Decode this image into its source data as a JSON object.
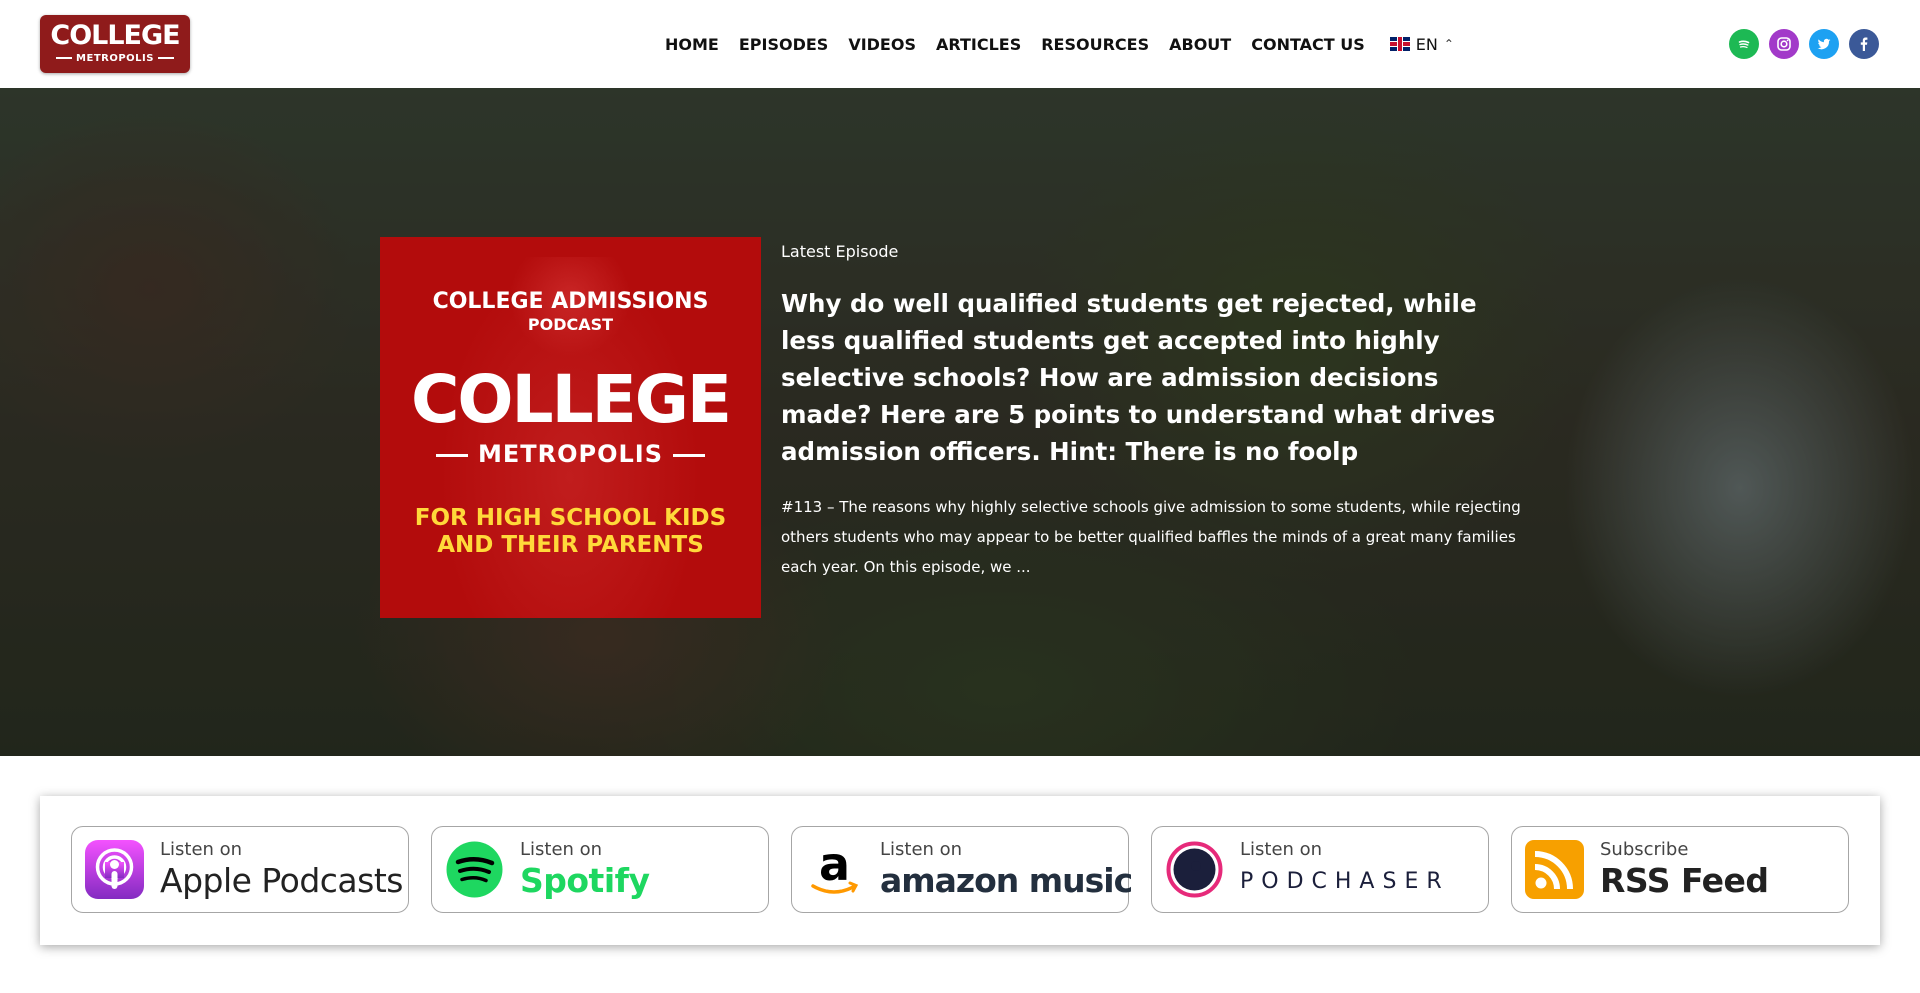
{
  "header": {
    "logo": {
      "name": "COLLEGE",
      "sub": "METROPOLIS"
    },
    "nav": [
      "HOME",
      "EPISODES",
      "VIDEOS",
      "ARTICLES",
      "RESOURCES",
      "ABOUT",
      "CONTACT US"
    ],
    "language": "EN",
    "social": [
      {
        "name": "spotify-icon",
        "color": "#1db954"
      },
      {
        "name": "instagram-icon",
        "color": "#a23ac9"
      },
      {
        "name": "twitter-icon",
        "color": "#1da1f2"
      },
      {
        "name": "facebook-icon",
        "color": "#3b5998"
      }
    ]
  },
  "hero": {
    "cover": {
      "line1": "COLLEGE ADMISSIONS",
      "line2": "PODCAST",
      "brand": "COLLEGE",
      "brand_sub": "METROPOLIS",
      "tagline_1": "FOR HIGH SCHOOL KIDS",
      "tagline_2": "AND THEIR PARENTS"
    },
    "label": "Latest Episode",
    "title": "Why do well qualified students get rejected, while less qualified students get accepted into highly selective schools? How are admission decisions made? Here are 5 points to understand what drives admission officers. Hint: There is no foolp",
    "description": "#113 – The reasons why highly selective schools give admission to some students, while rejecting others students who may appear to be better qualified baffles the minds of a great many families each year. On this episode, we ..."
  },
  "listen": [
    {
      "small": "Listen on",
      "big": "Apple Podcasts",
      "icon": "apple-podcasts-icon",
      "color": "#8e2ed2"
    },
    {
      "small": "Listen on",
      "big": "Spotify",
      "icon": "spotify-icon",
      "color": "#1ed760"
    },
    {
      "small": "Listen on",
      "big": "amazon music",
      "icon": "amazon-icon",
      "color": "#1399c4"
    },
    {
      "small": "Listen on",
      "big": "PODCHASER",
      "icon": "podchaser-icon",
      "color": "#e62a7a"
    },
    {
      "small": "Subscribe",
      "big": "RSS Feed",
      "icon": "rss-icon",
      "color": "#f7a000"
    }
  ]
}
